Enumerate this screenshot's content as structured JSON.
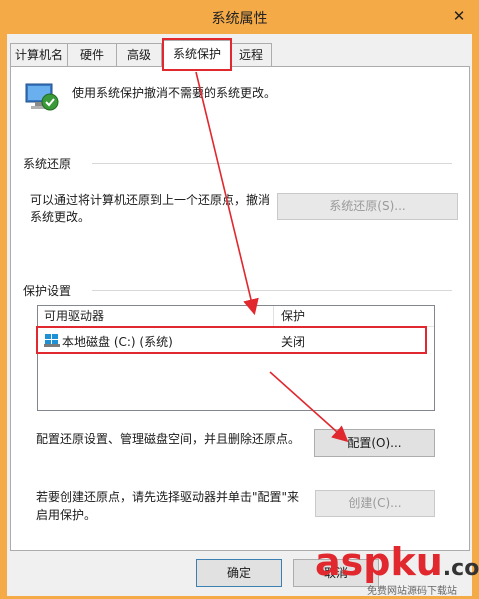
{
  "window": {
    "title": "系统属性",
    "close_glyph": "✕"
  },
  "tabs": [
    {
      "label": "计算机名"
    },
    {
      "label": "硬件"
    },
    {
      "label": "高级"
    },
    {
      "label": "系统保护"
    },
    {
      "label": "远程"
    }
  ],
  "intro_text": "使用系统保护撤消不需要的系统更改。",
  "restore": {
    "section_label": "系统还原",
    "description": "可以通过将计算机还原到上一个还原点，撤消系统更改。",
    "button_label": "系统还原(S)..."
  },
  "protection": {
    "section_label": "保护设置",
    "columns": [
      "可用驱动器",
      "保护"
    ],
    "rows": [
      {
        "drive": "本地磁盘 (C:) (系统)",
        "status": "关闭"
      }
    ],
    "config_text": "配置还原设置、管理磁盘空间，并且删除还原点。",
    "config_button": "配置(O)...",
    "create_text": "若要创建还原点，请先选择驱动器并单击\"配置\"来启用保护。",
    "create_button": "创建(C)..."
  },
  "footer": {
    "ok_label": "确定",
    "cancel_label": "取消"
  },
  "watermark": {
    "brand": "aspku",
    "tld": ".com",
    "subtitle": "免费网站源码下载站"
  },
  "colors": {
    "accent_red": "#e0282e",
    "title_bar": "#f4ab47"
  }
}
